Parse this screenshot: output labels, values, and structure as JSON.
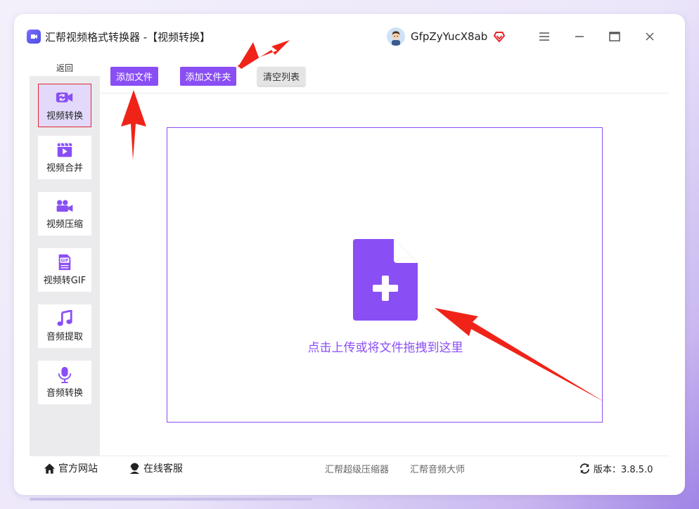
{
  "window": {
    "title": "汇帮视频格式转换器   -【视频转换】",
    "username": "GfpZyYucX8ab",
    "menu_icon": "hamburger-icon",
    "minimize_icon": "minimize-icon",
    "maximize_icon": "maximize-icon",
    "close_icon": "close-icon"
  },
  "sidebar": {
    "back_label": "返回",
    "items": [
      {
        "label": "视频转换",
        "icon": "video-convert-icon",
        "active": true
      },
      {
        "label": "视频合并",
        "icon": "video-merge-icon",
        "active": false
      },
      {
        "label": "视频压缩",
        "icon": "video-compress-icon",
        "active": false
      },
      {
        "label": "视频转GIF",
        "icon": "gif-icon",
        "active": false
      },
      {
        "label": "音频提取",
        "icon": "music-note-icon",
        "active": false
      },
      {
        "label": "音频转换",
        "icon": "microphone-icon",
        "active": false
      }
    ]
  },
  "toolbar": {
    "add_file_label": "添加文件",
    "add_folder_label": "添加文件夹",
    "clear_list_label": "清空列表"
  },
  "dropzone": {
    "hint": "点击上传或将文件拖拽到这里"
  },
  "footer": {
    "website_label": "官方网站",
    "support_label": "在线客服",
    "link_compressor": "汇帮超级压缩器",
    "link_audio": "汇帮音频大师",
    "version_label": "版本：3.8.5.0"
  },
  "colors": {
    "accent": "#8a4ef5",
    "active_border": "#e0282f",
    "active_bg": "#e2d9fb",
    "sidebar_bg": "#ebebee",
    "annotation_arrow": "#f02318"
  }
}
